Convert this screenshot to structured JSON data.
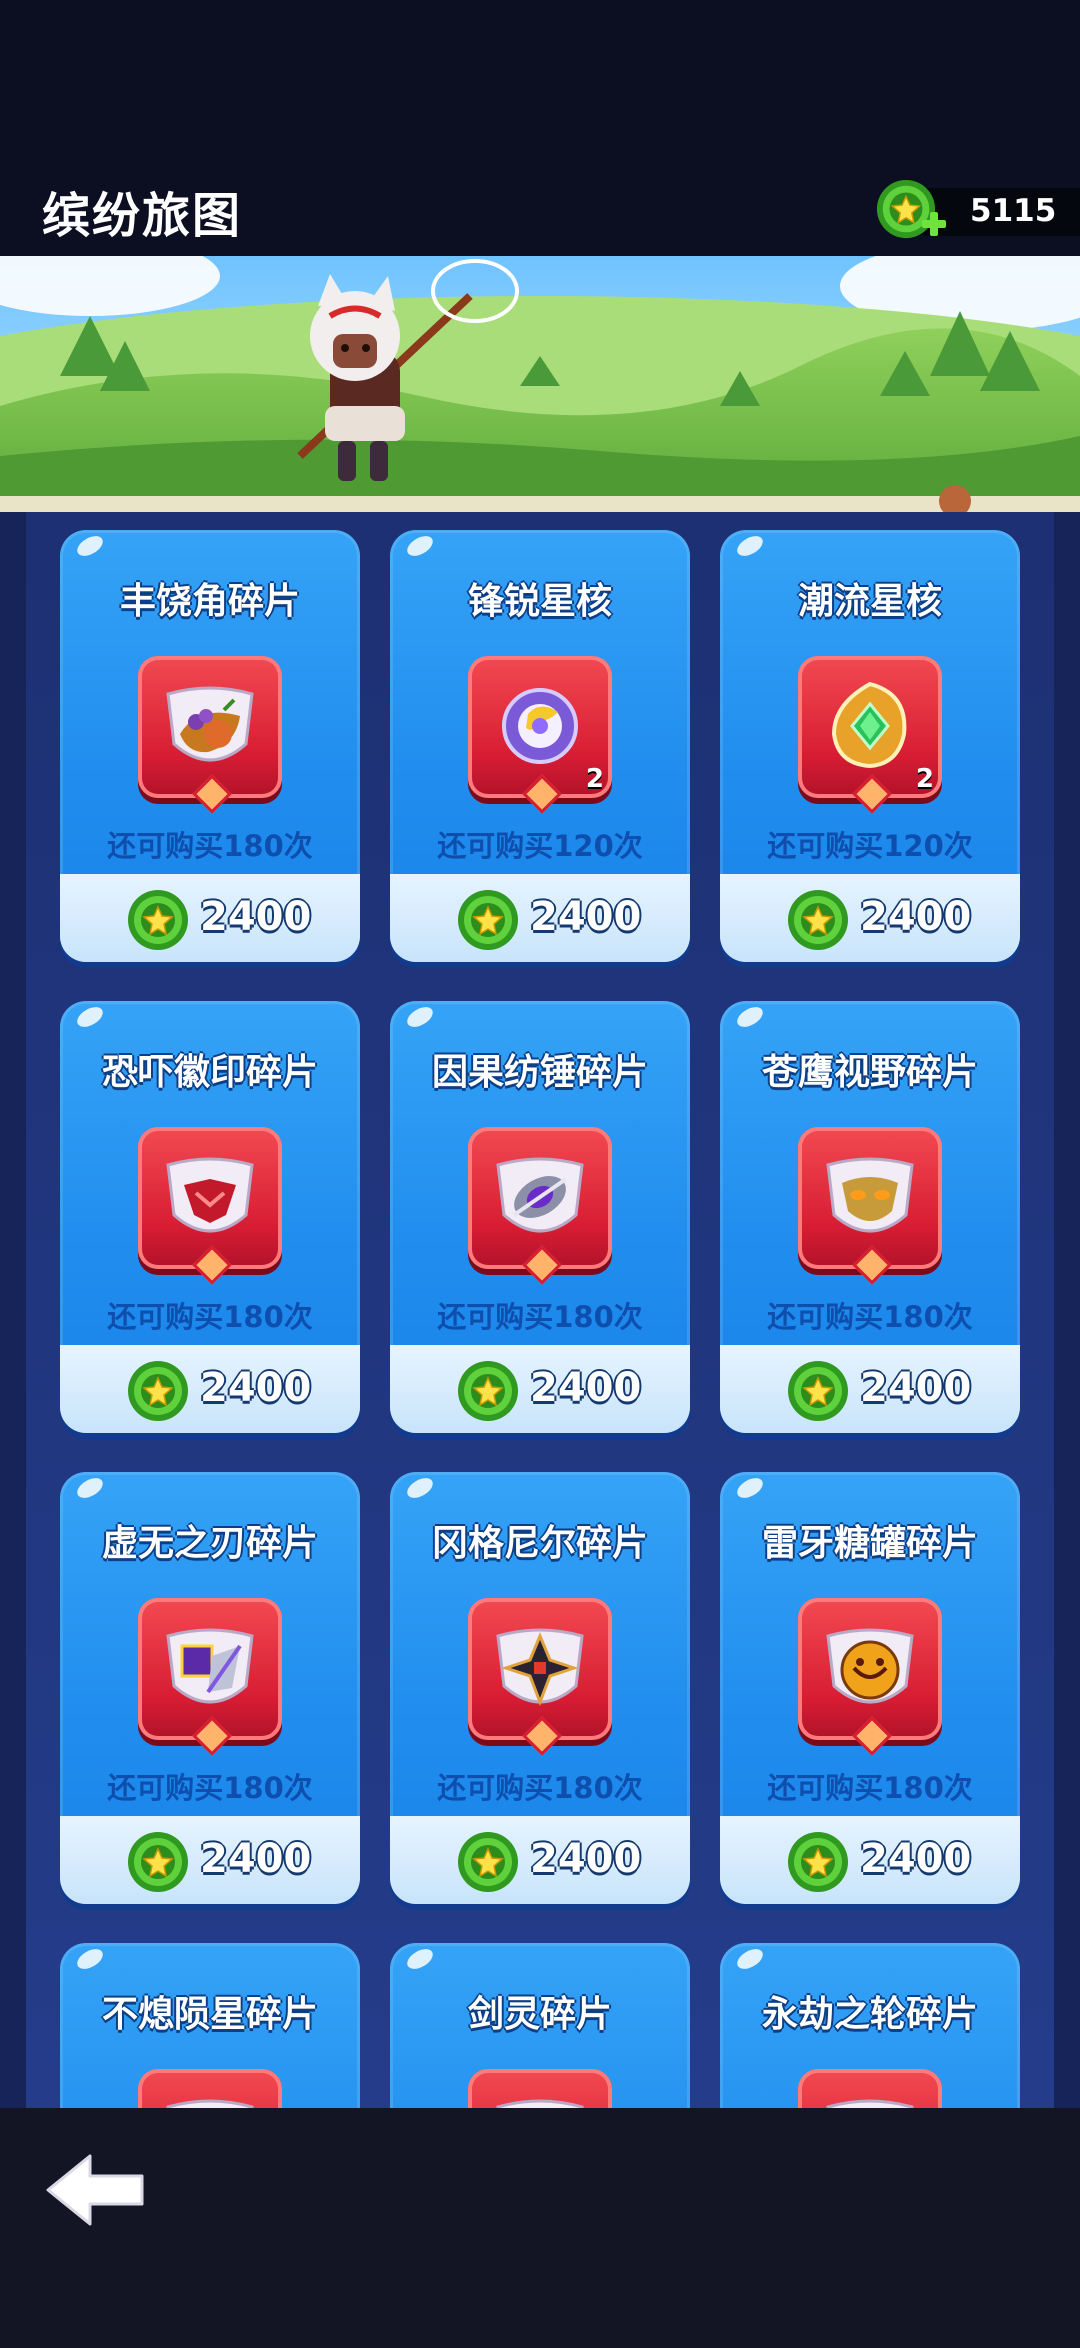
{
  "header": {
    "title": "缤纷旅图",
    "currency_amount": "5115",
    "currency_icon": "star-coin-icon",
    "add_icon": "plus-icon"
  },
  "banner": {
    "description_icon": "character-with-butterfly-net"
  },
  "shop": {
    "items": [
      {
        "name": "丰饶角碎片",
        "limit": "还可购买180次",
        "price": "2400",
        "qty": "",
        "icon": "cornucopia-icon"
      },
      {
        "name": "锋锐星核",
        "limit": "还可购买120次",
        "price": "2400",
        "qty": "2",
        "icon": "purple-star-core-icon"
      },
      {
        "name": "潮流星核",
        "limit": "还可购买120次",
        "price": "2400",
        "qty": "2",
        "icon": "green-star-core-icon"
      },
      {
        "name": "恐吓徽印碎片",
        "limit": "还可购买180次",
        "price": "2400",
        "qty": "",
        "icon": "red-emblem-icon"
      },
      {
        "name": "因果纺锤碎片",
        "limit": "还可购买180次",
        "price": "2400",
        "qty": "",
        "icon": "spindle-icon"
      },
      {
        "name": "苍鹰视野碎片",
        "limit": "还可购买180次",
        "price": "2400",
        "qty": "",
        "icon": "golden-mask-icon"
      },
      {
        "name": "虚无之刃碎片",
        "limit": "还可购买180次",
        "price": "2400",
        "qty": "",
        "icon": "void-blade-icon"
      },
      {
        "name": "冈格尼尔碎片",
        "limit": "还可购买180次",
        "price": "2400",
        "qty": "",
        "icon": "spear-star-icon"
      },
      {
        "name": "雷牙糖罐碎片",
        "limit": "还可购买180次",
        "price": "2400",
        "qty": "",
        "icon": "candy-jar-icon"
      },
      {
        "name": "不熄陨星碎片",
        "limit": "",
        "price": "",
        "qty": "",
        "icon": "meteor-icon"
      },
      {
        "name": "剑灵碎片",
        "limit": "",
        "price": "",
        "qty": "",
        "icon": "sword-spirit-icon"
      },
      {
        "name": "永劫之轮碎片",
        "limit": "",
        "price": "",
        "qty": "",
        "icon": "eternal-wheel-icon"
      }
    ]
  },
  "footer": {
    "back_icon": "back-arrow-icon"
  },
  "colors": {
    "card_blue": "#2496f0",
    "frame_red": "#d81d33",
    "coin_green": "#3cb82b",
    "background": "#0c0f22"
  }
}
